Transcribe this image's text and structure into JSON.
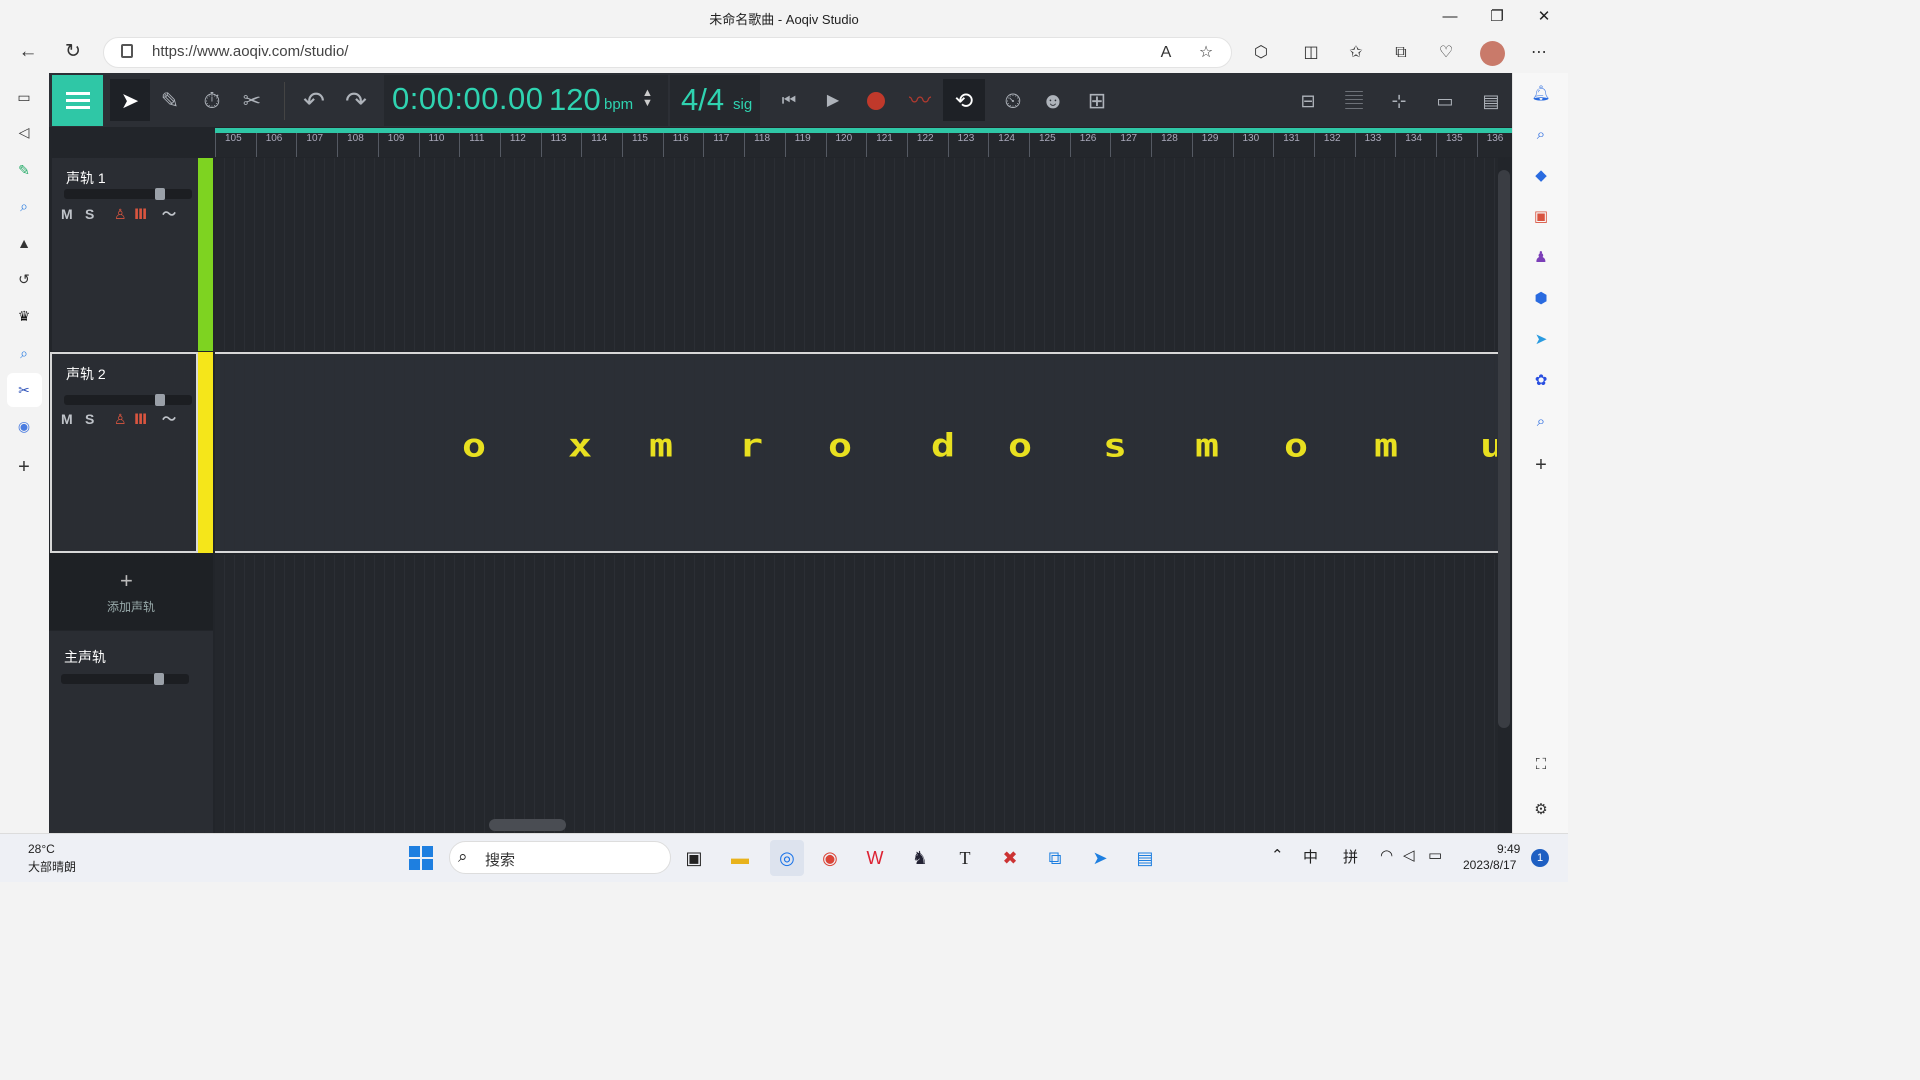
{
  "window": {
    "title": "未命名歌曲 - Aoqiv Studio",
    "minimize": "—",
    "maximize": "❐",
    "close": "✕"
  },
  "browser": {
    "url": "https://www.aoqiv.com/studio/",
    "back": "←",
    "refresh": "↻",
    "more": "⋯"
  },
  "app": {
    "time": "0:00:00.00",
    "bpm": "120",
    "bpm_unit": "bpm",
    "signature": "4/4",
    "signature_unit": "sig",
    "accent_color": "#2fc7a6"
  },
  "ruler": {
    "ticks": [
      "105",
      "106",
      "107",
      "108",
      "109",
      "110",
      "111",
      "112",
      "113",
      "114",
      "115",
      "116",
      "117",
      "118",
      "119",
      "120",
      "121",
      "122",
      "123",
      "124",
      "125",
      "126",
      "127",
      "128",
      "129",
      "130",
      "131",
      "132",
      "133",
      "134",
      "135",
      "136"
    ]
  },
  "tracks": [
    {
      "name": "声轨 1",
      "color": "#7ed321",
      "mute": "M",
      "solo": "S"
    },
    {
      "name": "声轨 2",
      "color": "#f5e61a",
      "mute": "M",
      "solo": "S"
    }
  ],
  "add_track": {
    "icon": "+",
    "label": "添加声轨"
  },
  "master": {
    "name": "主声轨"
  },
  "notes_text": "o x m r o d o s m o m u",
  "taskbar": {
    "temperature": "28°C",
    "weather": "大部晴朗",
    "search_placeholder": "搜索",
    "time": "9:49",
    "date": "2023/8/17",
    "ime_lang": "中",
    "ime_mode": "拼",
    "notification_count": "1"
  }
}
